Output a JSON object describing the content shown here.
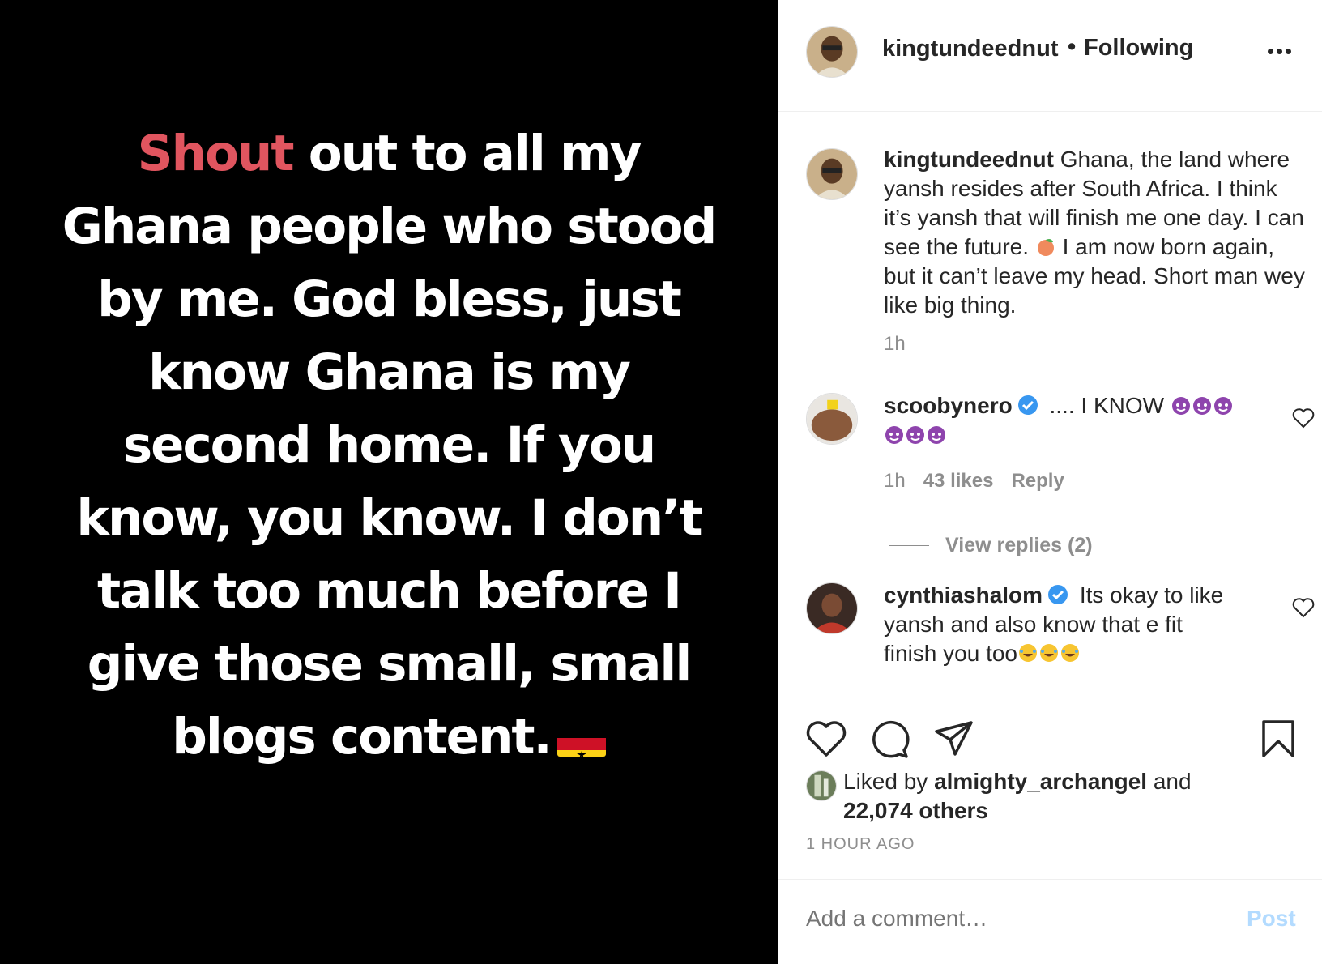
{
  "post_image": {
    "highlight": "Shout",
    "text": " out to all my Ghana people who stood by me. God bless, just know Ghana is my second home. If you know, you know. I don’t talk too much before I give those small, small blogs content."
  },
  "header": {
    "username": "kingtundeednut",
    "separator": "•",
    "follow_status": "Following"
  },
  "caption": {
    "username": "kingtundeednut",
    "text": " Ghana, the land where yansh resides after South Africa. I think it’s yansh that will finish me one day. I can see the future. ",
    "text2": " I am now born again, but it can’t leave my head. Short man wey like big thing.",
    "time": "1h"
  },
  "comments": [
    {
      "username": "scoobynero",
      "text": " .... I KNOW ",
      "time": "1h",
      "likes": "43 likes",
      "reply": "Reply",
      "view_replies": "View replies (2)"
    },
    {
      "username": "cynthiashalom",
      "text": " Its okay to like yansh and also know that e fit finish you too"
    }
  ],
  "liked_by": {
    "prefix": "Liked by ",
    "user": "almighty_archangel",
    "middle": " and ",
    "others": "22,074 others"
  },
  "timestamp": "1 HOUR AGO",
  "add_comment": {
    "placeholder": "Add a comment…",
    "post_label": "Post"
  },
  "colors": {
    "highlight_red": "#e0555f",
    "verified_blue": "#3897f0",
    "post_disabled": "#b3dbff"
  }
}
